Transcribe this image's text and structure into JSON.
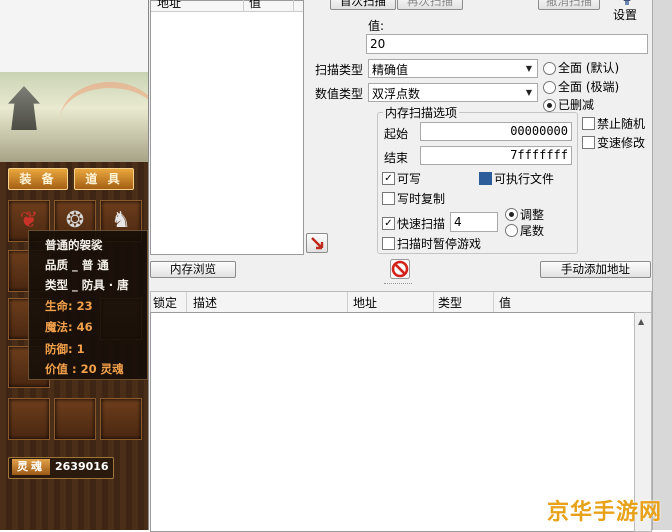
{
  "game": {
    "tabs": [
      "装 备",
      "道 具"
    ],
    "tooltip": {
      "name": "普通的袈裟",
      "quality": "品质 _ 普 通",
      "type": "类型 _ 防具 · 唐",
      "life": "生命: 23",
      "magic": "魔法: 46",
      "defense": "防御: 1",
      "value": "价值 : 20 灵魂"
    },
    "soul_label": "灵魂",
    "soul_value": "2639016"
  },
  "ce": {
    "addr_header": [
      "地址",
      "值"
    ],
    "first_scan": "首次扫描",
    "next_scan": "再次扫描",
    "undo_scan": "撤消扫描",
    "settings": "设置",
    "value_label": "值:",
    "value_input": "20",
    "scan_type_label": "扫描类型",
    "scan_type_value": "精确值",
    "value_type_label": "数值类型",
    "value_type_value": "双浮点数",
    "radio_all_default": "全面 (默认)",
    "radio_all_extreme": "全面 (极端)",
    "radio_trimmed": "已删减",
    "mem_options_title": "内存扫描选项",
    "start_label": "起始",
    "start_value": "00000000",
    "end_label": "结束",
    "end_value": "7fffffff",
    "writable": "可写",
    "executable": "可执行文件",
    "copy_on_write": "写时复制",
    "fast_scan": "快速扫描",
    "fast_scan_value": "4",
    "align": "调整",
    "last_digits": "尾数",
    "pause_game": "扫描时暂停游戏",
    "disable_random": "禁止随机",
    "speed_modify": "变速修改",
    "memory_view": "内存浏览",
    "add_address": "手动添加地址",
    "columns": [
      "锁定",
      "描述",
      "地址",
      "类型",
      "值"
    ]
  },
  "watermark": "京华手游网"
}
